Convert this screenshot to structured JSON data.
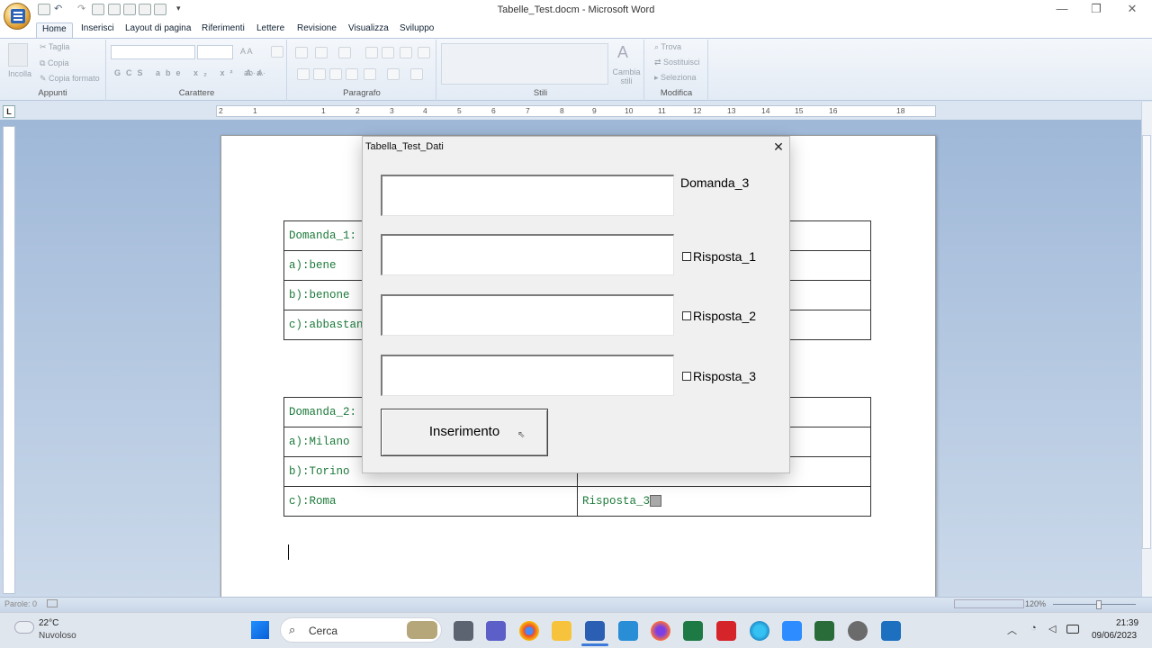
{
  "window": {
    "title": "Tabelle_Test.docm - Microsoft Word",
    "minimize": "—",
    "maximize": "❐",
    "close": "✕"
  },
  "tabs": [
    "Home",
    "Inserisci",
    "Layout di pagina",
    "Riferimenti",
    "Lettere",
    "Revisione",
    "Visualizza",
    "Sviluppo"
  ],
  "ribbon": {
    "appunti": {
      "label": "Appunti",
      "incolla": "Incolla",
      "taglia": "Taglia",
      "copia": "Copia",
      "copia_formato": "Copia formato"
    },
    "carattere": {
      "label": "Carattere"
    },
    "paragrafo": {
      "label": "Paragrafo"
    },
    "stili": {
      "label": "Stili",
      "cambia_stili": "Cambia stili"
    },
    "modifica": {
      "label": "Modifica",
      "trova": "Trova",
      "sostituisci": "Sostituisci",
      "seleziona": "Seleziona"
    }
  },
  "ruler": {
    "corner": "L",
    "numbers": [
      "2",
      "1",
      "1",
      "2",
      "3",
      "4",
      "5",
      "6",
      "7",
      "8",
      "9",
      "10",
      "11",
      "12",
      "13",
      "14",
      "15",
      "16",
      "18"
    ]
  },
  "document": {
    "table1": [
      [
        "Domanda_1:",
        ""
      ],
      [
        "a):bene",
        ""
      ],
      [
        "b):benone",
        ""
      ],
      [
        "c):abbastanza",
        ""
      ]
    ],
    "table2": [
      [
        "Domanda_2:",
        ""
      ],
      [
        "a):Milano",
        ""
      ],
      [
        "b):Torino",
        ""
      ],
      [
        "c):Roma",
        "Risposta_3"
      ]
    ]
  },
  "dialog": {
    "title": "Tabella_Test_Dati",
    "close": "✕",
    "labels": {
      "domanda": "Domanda_3",
      "risposta1": "Risposta_1",
      "risposta2": "Risposta_2",
      "risposta3": "Risposta_3"
    },
    "button": "Inserimento"
  },
  "statusbar": {
    "words": "Parole: 0",
    "zoom": "120%"
  },
  "taskbar": {
    "weather_temp": "22°C",
    "weather_desc": "Nuvoloso",
    "search": "Cerca",
    "time": "21:39",
    "date": "09/06/2023"
  }
}
